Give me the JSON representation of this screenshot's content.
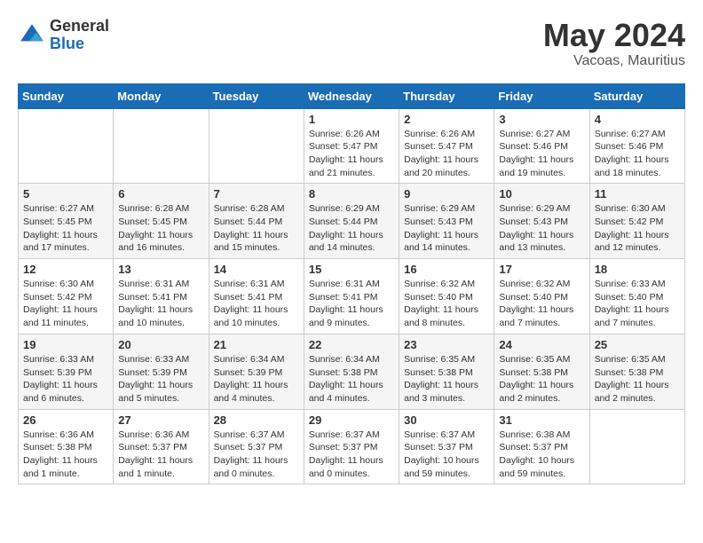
{
  "header": {
    "logo_general": "General",
    "logo_blue": "Blue",
    "month_year": "May 2024",
    "location": "Vacoas, Mauritius"
  },
  "days_of_week": [
    "Sunday",
    "Monday",
    "Tuesday",
    "Wednesday",
    "Thursday",
    "Friday",
    "Saturday"
  ],
  "weeks": [
    [
      {
        "day": "",
        "info": ""
      },
      {
        "day": "",
        "info": ""
      },
      {
        "day": "",
        "info": ""
      },
      {
        "day": "1",
        "info": "Sunrise: 6:26 AM\nSunset: 5:47 PM\nDaylight: 11 hours and 21 minutes."
      },
      {
        "day": "2",
        "info": "Sunrise: 6:26 AM\nSunset: 5:47 PM\nDaylight: 11 hours and 20 minutes."
      },
      {
        "day": "3",
        "info": "Sunrise: 6:27 AM\nSunset: 5:46 PM\nDaylight: 11 hours and 19 minutes."
      },
      {
        "day": "4",
        "info": "Sunrise: 6:27 AM\nSunset: 5:46 PM\nDaylight: 11 hours and 18 minutes."
      }
    ],
    [
      {
        "day": "5",
        "info": "Sunrise: 6:27 AM\nSunset: 5:45 PM\nDaylight: 11 hours and 17 minutes."
      },
      {
        "day": "6",
        "info": "Sunrise: 6:28 AM\nSunset: 5:45 PM\nDaylight: 11 hours and 16 minutes."
      },
      {
        "day": "7",
        "info": "Sunrise: 6:28 AM\nSunset: 5:44 PM\nDaylight: 11 hours and 15 minutes."
      },
      {
        "day": "8",
        "info": "Sunrise: 6:29 AM\nSunset: 5:44 PM\nDaylight: 11 hours and 14 minutes."
      },
      {
        "day": "9",
        "info": "Sunrise: 6:29 AM\nSunset: 5:43 PM\nDaylight: 11 hours and 14 minutes."
      },
      {
        "day": "10",
        "info": "Sunrise: 6:29 AM\nSunset: 5:43 PM\nDaylight: 11 hours and 13 minutes."
      },
      {
        "day": "11",
        "info": "Sunrise: 6:30 AM\nSunset: 5:42 PM\nDaylight: 11 hours and 12 minutes."
      }
    ],
    [
      {
        "day": "12",
        "info": "Sunrise: 6:30 AM\nSunset: 5:42 PM\nDaylight: 11 hours and 11 minutes."
      },
      {
        "day": "13",
        "info": "Sunrise: 6:31 AM\nSunset: 5:41 PM\nDaylight: 11 hours and 10 minutes."
      },
      {
        "day": "14",
        "info": "Sunrise: 6:31 AM\nSunset: 5:41 PM\nDaylight: 11 hours and 10 minutes."
      },
      {
        "day": "15",
        "info": "Sunrise: 6:31 AM\nSunset: 5:41 PM\nDaylight: 11 hours and 9 minutes."
      },
      {
        "day": "16",
        "info": "Sunrise: 6:32 AM\nSunset: 5:40 PM\nDaylight: 11 hours and 8 minutes."
      },
      {
        "day": "17",
        "info": "Sunrise: 6:32 AM\nSunset: 5:40 PM\nDaylight: 11 hours and 7 minutes."
      },
      {
        "day": "18",
        "info": "Sunrise: 6:33 AM\nSunset: 5:40 PM\nDaylight: 11 hours and 7 minutes."
      }
    ],
    [
      {
        "day": "19",
        "info": "Sunrise: 6:33 AM\nSunset: 5:39 PM\nDaylight: 11 hours and 6 minutes."
      },
      {
        "day": "20",
        "info": "Sunrise: 6:33 AM\nSunset: 5:39 PM\nDaylight: 11 hours and 5 minutes."
      },
      {
        "day": "21",
        "info": "Sunrise: 6:34 AM\nSunset: 5:39 PM\nDaylight: 11 hours and 4 minutes."
      },
      {
        "day": "22",
        "info": "Sunrise: 6:34 AM\nSunset: 5:38 PM\nDaylight: 11 hours and 4 minutes."
      },
      {
        "day": "23",
        "info": "Sunrise: 6:35 AM\nSunset: 5:38 PM\nDaylight: 11 hours and 3 minutes."
      },
      {
        "day": "24",
        "info": "Sunrise: 6:35 AM\nSunset: 5:38 PM\nDaylight: 11 hours and 2 minutes."
      },
      {
        "day": "25",
        "info": "Sunrise: 6:35 AM\nSunset: 5:38 PM\nDaylight: 11 hours and 2 minutes."
      }
    ],
    [
      {
        "day": "26",
        "info": "Sunrise: 6:36 AM\nSunset: 5:38 PM\nDaylight: 11 hours and 1 minute."
      },
      {
        "day": "27",
        "info": "Sunrise: 6:36 AM\nSunset: 5:37 PM\nDaylight: 11 hours and 1 minute."
      },
      {
        "day": "28",
        "info": "Sunrise: 6:37 AM\nSunset: 5:37 PM\nDaylight: 11 hours and 0 minutes."
      },
      {
        "day": "29",
        "info": "Sunrise: 6:37 AM\nSunset: 5:37 PM\nDaylight: 11 hours and 0 minutes."
      },
      {
        "day": "30",
        "info": "Sunrise: 6:37 AM\nSunset: 5:37 PM\nDaylight: 10 hours and 59 minutes."
      },
      {
        "day": "31",
        "info": "Sunrise: 6:38 AM\nSunset: 5:37 PM\nDaylight: 10 hours and 59 minutes."
      },
      {
        "day": "",
        "info": ""
      }
    ]
  ]
}
